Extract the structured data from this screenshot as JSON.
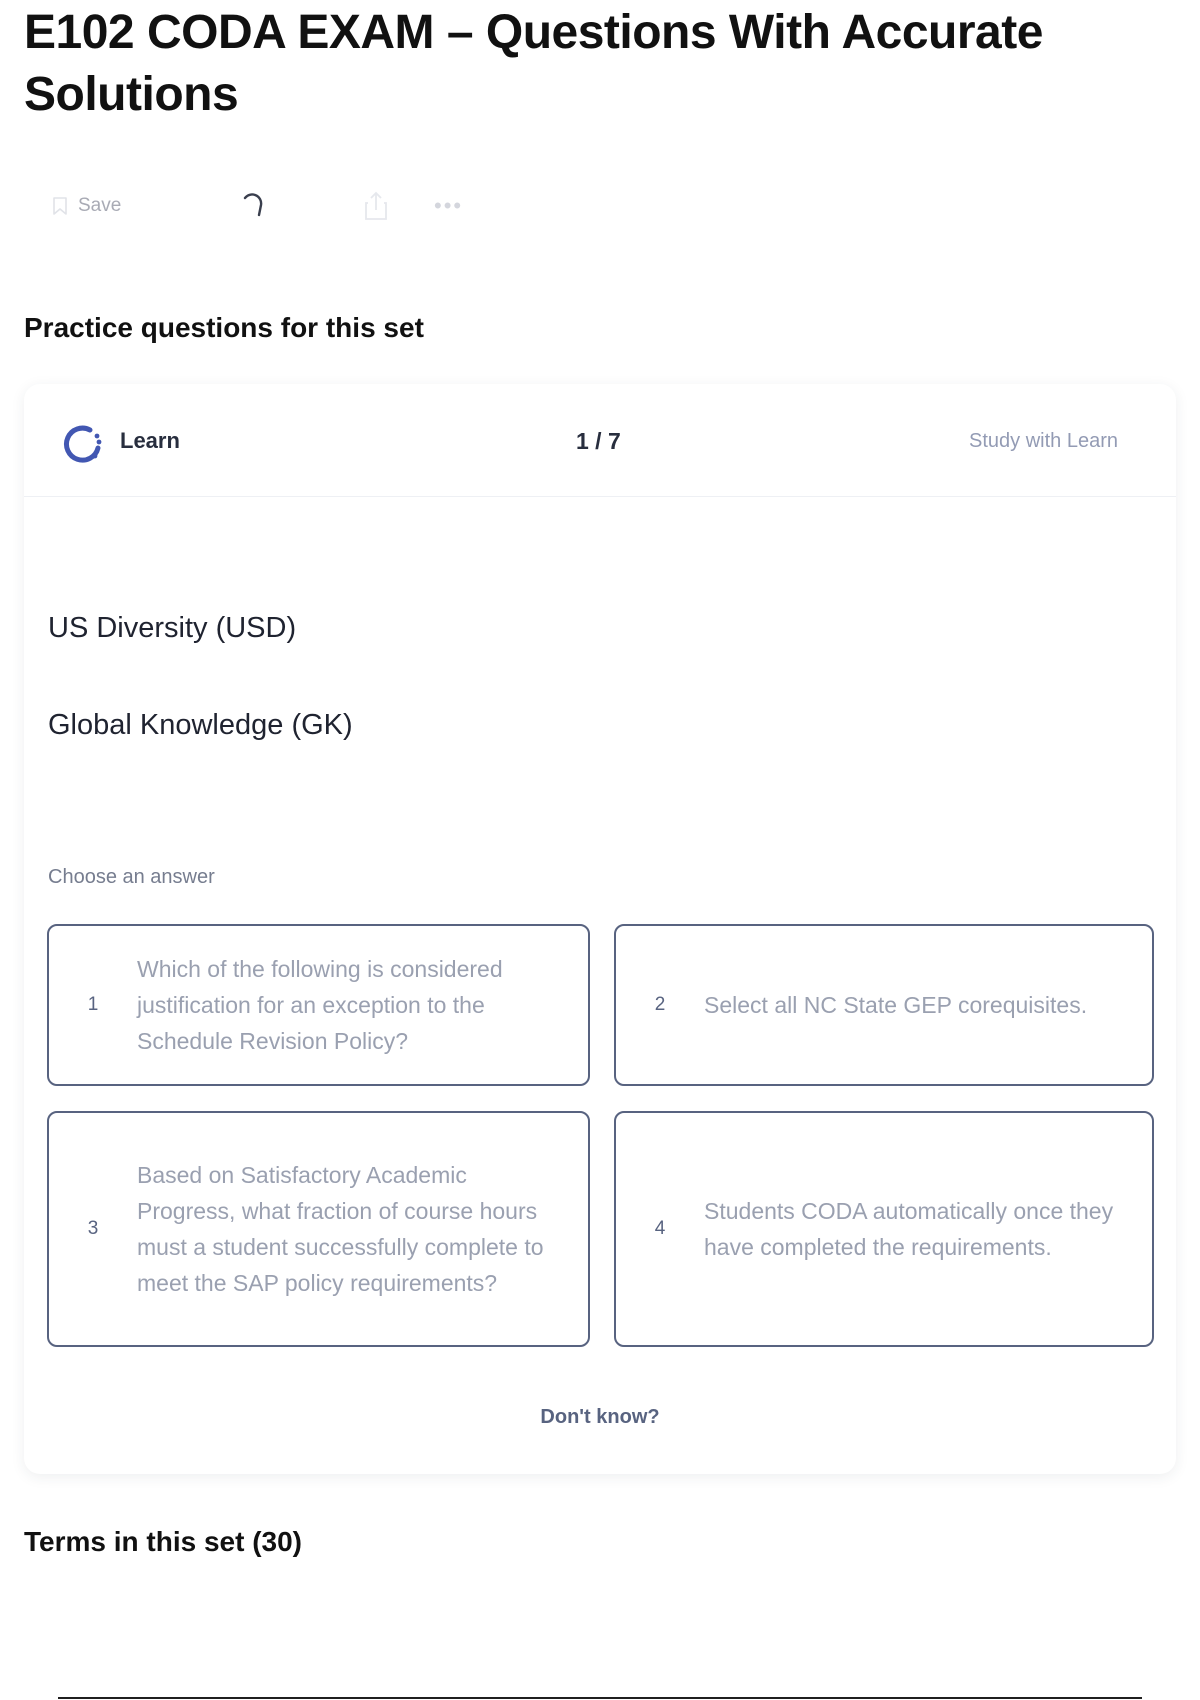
{
  "page": {
    "title": "E102 CODA EXAM – Questions With Accurate Solutions"
  },
  "toolbar": {
    "save_label": "Save",
    "icons": [
      "bookmark-icon",
      "loading-spinner-icon",
      "share-icon",
      "more-icon"
    ]
  },
  "practice": {
    "heading": "Practice questions for this set",
    "mode_label": "Learn",
    "progress": "1 / 7",
    "study_link": "Study with Learn",
    "prompt_terms": [
      "US Diversity (USD)",
      "Global Knowledge (GK)"
    ],
    "choose_label": "Choose an answer",
    "options": [
      {
        "number": "1",
        "text": "Which of the following is considered justification for an exception to the Schedule Revision Policy?"
      },
      {
        "number": "2",
        "text": "Select all NC State GEP corequisites."
      },
      {
        "number": "3",
        "text": "Based on Satisfactory Academic Progress, what fraction of course hours must a student successfully complete to meet the SAP policy requirements?"
      },
      {
        "number": "4",
        "text": "Students CODA automatically once they have completed the requirements."
      }
    ],
    "dont_know": "Don't know?"
  },
  "terms": {
    "heading": "Terms in this set (30)"
  },
  "colors": {
    "learn_icon": "#4257b2",
    "option_border": "#586380",
    "option_text": "#9aa0b0"
  }
}
